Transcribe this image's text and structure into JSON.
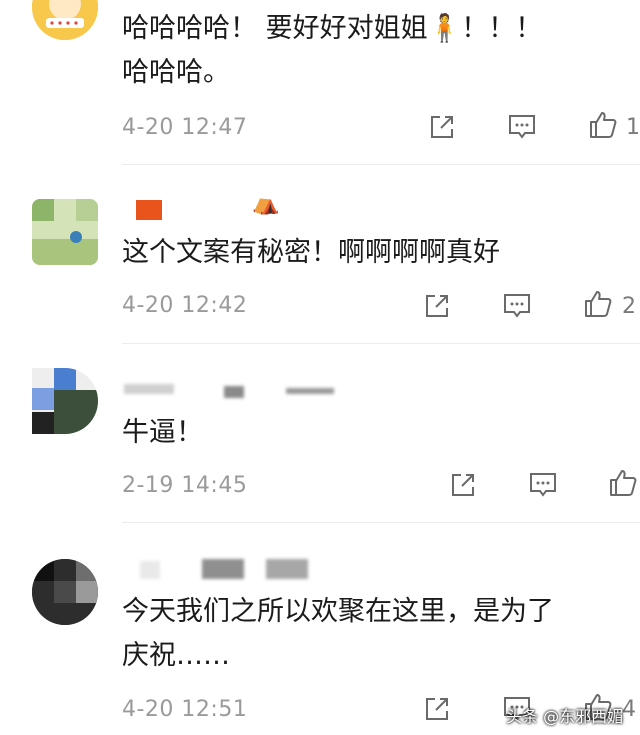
{
  "comments": [
    {
      "text_line1": "哈哈哈哈！ 要好好对姐姐🧍！！！",
      "text_line2": "哈哈哈。",
      "time": "4-20 12:47",
      "like_count": "1"
    },
    {
      "text_line1": "这个文案有秘密！啊啊啊啊真好",
      "time": "4-20 12:42",
      "like_count": "2"
    },
    {
      "text_line1": "牛逼！",
      "time": "2-19 14:45",
      "like_count": ""
    },
    {
      "text_line1": "今天我们之所以欢聚在这里，是为了",
      "text_line2": "庆祝……",
      "time": "4-20 12:51",
      "like_count": "4"
    }
  ],
  "watermark": "头条 @东邪西媚",
  "icons": {
    "share": "share-icon",
    "reply": "reply-icon",
    "like": "thumbs-up-icon"
  }
}
